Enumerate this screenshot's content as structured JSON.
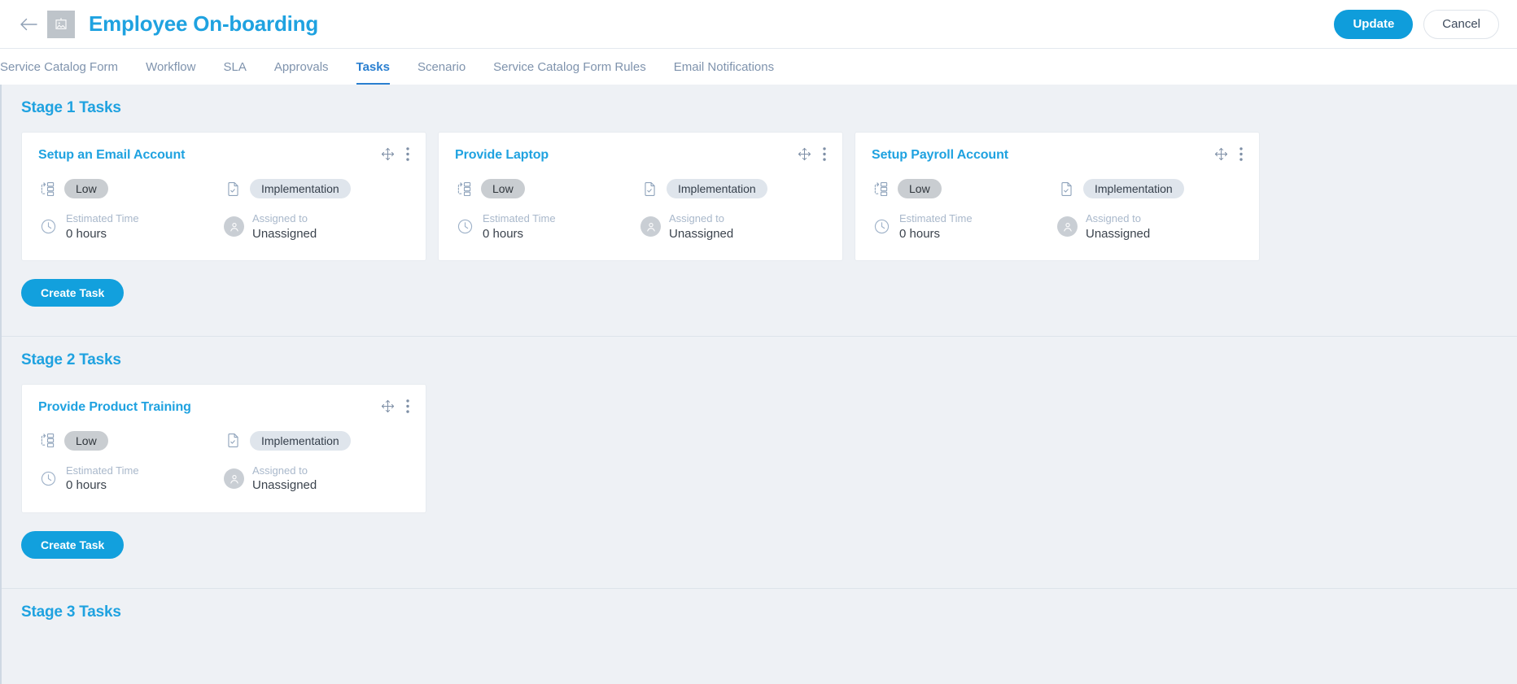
{
  "header": {
    "back_icon": "back-arrow-icon",
    "thumbnail_icon": "image-placeholder-icon",
    "title": "Employee On-boarding",
    "update_label": "Update",
    "cancel_label": "Cancel",
    "accent_color": "#1fa2e0",
    "primary_button_color": "#0f9ddb"
  },
  "tabs": [
    {
      "label": "Service Catalog Form",
      "active": false
    },
    {
      "label": "Workflow",
      "active": false
    },
    {
      "label": "SLA",
      "active": false
    },
    {
      "label": "Approvals",
      "active": false
    },
    {
      "label": "Tasks",
      "active": true
    },
    {
      "label": "Scenario",
      "active": false
    },
    {
      "label": "Service Catalog Form Rules",
      "active": false
    },
    {
      "label": "Email Notifications",
      "active": false
    }
  ],
  "labels": {
    "estimated_time": "Estimated Time",
    "assigned_to": "Assigned to",
    "create_task": "Create Task",
    "drag_icon": "move-handle-icon",
    "menu_icon": "more-vertical-icon",
    "priority_icon": "priority-list-icon",
    "type_icon": "document-check-icon",
    "clock_icon": "clock-icon",
    "user_icon": "user-avatar-icon"
  },
  "stages": [
    {
      "title": "Stage 1 Tasks",
      "create_label": "Create Task",
      "tasks": [
        {
          "title": "Setup an Email Account",
          "priority": "Low",
          "type": "Implementation",
          "estimated_time": "0 hours",
          "assignee": "Unassigned"
        },
        {
          "title": "Provide Laptop",
          "priority": "Low",
          "type": "Implementation",
          "estimated_time": "0 hours",
          "assignee": "Unassigned"
        },
        {
          "title": "Setup Payroll Account",
          "priority": "Low",
          "type": "Implementation",
          "estimated_time": "0 hours",
          "assignee": "Unassigned"
        }
      ]
    },
    {
      "title": "Stage 2 Tasks",
      "create_label": "Create Task",
      "tasks": [
        {
          "title": "Provide Product Training",
          "priority": "Low",
          "type": "Implementation",
          "estimated_time": "0 hours",
          "assignee": "Unassigned"
        }
      ]
    },
    {
      "title": "Stage 3 Tasks",
      "create_label": "",
      "tasks": []
    }
  ]
}
